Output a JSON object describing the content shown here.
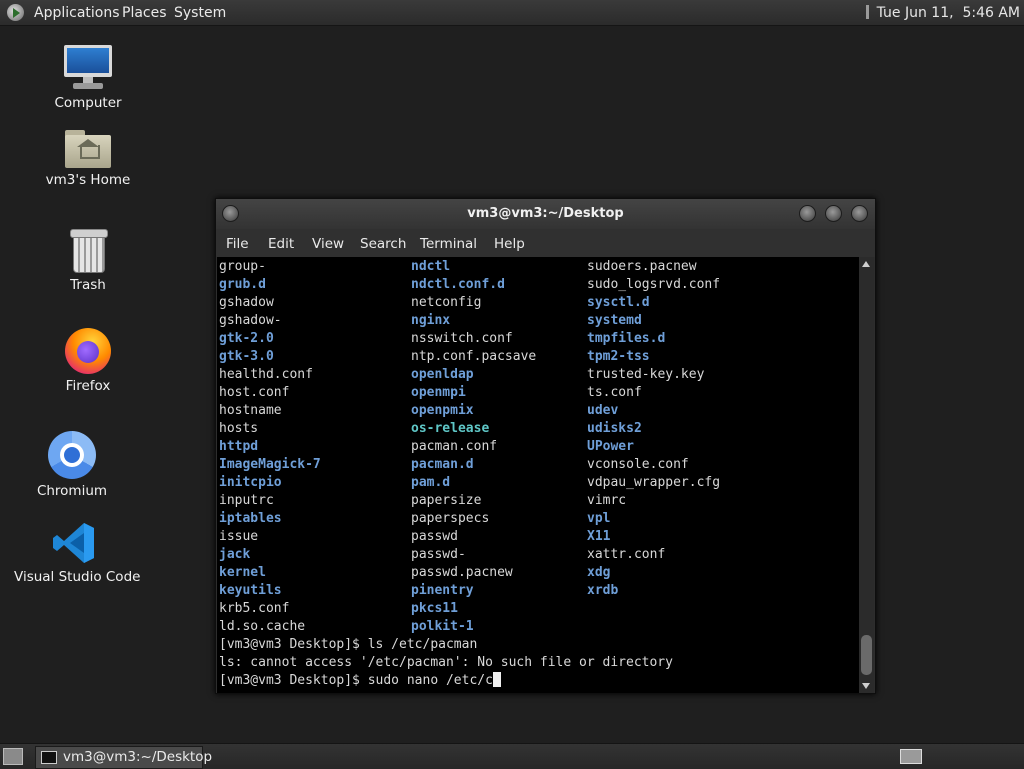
{
  "top_panel": {
    "menus": [
      "Applications",
      "Places",
      "System"
    ],
    "clock": "Tue Jun 11,  5:46 AM"
  },
  "desktop_icons": [
    {
      "label": "Computer",
      "icon": "computer-icon"
    },
    {
      "label": "vm3's Home",
      "icon": "home-folder-icon"
    },
    {
      "label": "Trash",
      "icon": "trash-icon"
    },
    {
      "label": "Firefox",
      "icon": "firefox-icon"
    },
    {
      "label": "Chromium",
      "icon": "chromium-icon"
    },
    {
      "label": "Visual Studio Code",
      "icon": "vscode-icon"
    }
  ],
  "terminal": {
    "title": "vm3@vm3:~/Desktop",
    "menu": [
      "File",
      "Edit",
      "View",
      "Search",
      "Terminal",
      "Help"
    ],
    "listing": [
      [
        {
          "t": "group-",
          "c": "file"
        },
        {
          "t": "ndctl",
          "c": "dir"
        },
        {
          "t": "sudoers.pacnew",
          "c": "file"
        }
      ],
      [
        {
          "t": "grub.d",
          "c": "dir"
        },
        {
          "t": "ndctl.conf.d",
          "c": "dir"
        },
        {
          "t": "sudo_logsrvd.conf",
          "c": "file"
        }
      ],
      [
        {
          "t": "gshadow",
          "c": "file"
        },
        {
          "t": "netconfig",
          "c": "file"
        },
        {
          "t": "sysctl.d",
          "c": "dir"
        }
      ],
      [
        {
          "t": "gshadow-",
          "c": "file"
        },
        {
          "t": "nginx",
          "c": "dir"
        },
        {
          "t": "systemd",
          "c": "dir"
        }
      ],
      [
        {
          "t": "gtk-2.0",
          "c": "dir"
        },
        {
          "t": "nsswitch.conf",
          "c": "file"
        },
        {
          "t": "tmpfiles.d",
          "c": "dir"
        }
      ],
      [
        {
          "t": "gtk-3.0",
          "c": "dir"
        },
        {
          "t": "ntp.conf.pacsave",
          "c": "file"
        },
        {
          "t": "tpm2-tss",
          "c": "dir"
        }
      ],
      [
        {
          "t": "healthd.conf",
          "c": "file"
        },
        {
          "t": "openldap",
          "c": "dir"
        },
        {
          "t": "trusted-key.key",
          "c": "file"
        }
      ],
      [
        {
          "t": "host.conf",
          "c": "file"
        },
        {
          "t": "openmpi",
          "c": "dir"
        },
        {
          "t": "ts.conf",
          "c": "file"
        }
      ],
      [
        {
          "t": "hostname",
          "c": "file"
        },
        {
          "t": "openpmix",
          "c": "dir"
        },
        {
          "t": "udev",
          "c": "dir"
        }
      ],
      [
        {
          "t": "hosts",
          "c": "file"
        },
        {
          "t": "os-release",
          "c": "link"
        },
        {
          "t": "udisks2",
          "c": "dir"
        }
      ],
      [
        {
          "t": "httpd",
          "c": "dir"
        },
        {
          "t": "pacman.conf",
          "c": "file"
        },
        {
          "t": "UPower",
          "c": "dir"
        }
      ],
      [
        {
          "t": "ImageMagick-7",
          "c": "dir"
        },
        {
          "t": "pacman.d",
          "c": "dir"
        },
        {
          "t": "vconsole.conf",
          "c": "file"
        }
      ],
      [
        {
          "t": "initcpio",
          "c": "dir"
        },
        {
          "t": "pam.d",
          "c": "dir"
        },
        {
          "t": "vdpau_wrapper.cfg",
          "c": "file"
        }
      ],
      [
        {
          "t": "inputrc",
          "c": "file"
        },
        {
          "t": "papersize",
          "c": "file"
        },
        {
          "t": "vimrc",
          "c": "file"
        }
      ],
      [
        {
          "t": "iptables",
          "c": "dir"
        },
        {
          "t": "paperspecs",
          "c": "file"
        },
        {
          "t": "vpl",
          "c": "dir"
        }
      ],
      [
        {
          "t": "issue",
          "c": "file"
        },
        {
          "t": "passwd",
          "c": "file"
        },
        {
          "t": "X11",
          "c": "dir"
        }
      ],
      [
        {
          "t": "jack",
          "c": "dir"
        },
        {
          "t": "passwd-",
          "c": "file"
        },
        {
          "t": "xattr.conf",
          "c": "file"
        }
      ],
      [
        {
          "t": "kernel",
          "c": "dir"
        },
        {
          "t": "passwd.pacnew",
          "c": "file"
        },
        {
          "t": "xdg",
          "c": "dir"
        }
      ],
      [
        {
          "t": "keyutils",
          "c": "dir"
        },
        {
          "t": "pinentry",
          "c": "dir"
        },
        {
          "t": "xrdb",
          "c": "dir"
        }
      ],
      [
        {
          "t": "krb5.conf",
          "c": "file"
        },
        {
          "t": "pkcs11",
          "c": "dir"
        },
        {
          "t": "",
          "c": "file"
        }
      ],
      [
        {
          "t": "ld.so.cache",
          "c": "file"
        },
        {
          "t": "polkit-1",
          "c": "dir"
        },
        {
          "t": "",
          "c": "file"
        }
      ]
    ],
    "output_lines": [
      "[vm3@vm3 Desktop]$ ls /etc/pacman",
      "ls: cannot access '/etc/pacman': No such file or directory"
    ],
    "prompt": "[vm3@vm3 Desktop]$ sudo nano /etc/c"
  },
  "bottom_panel": {
    "task_label": "vm3@vm3:~/Desktop"
  }
}
